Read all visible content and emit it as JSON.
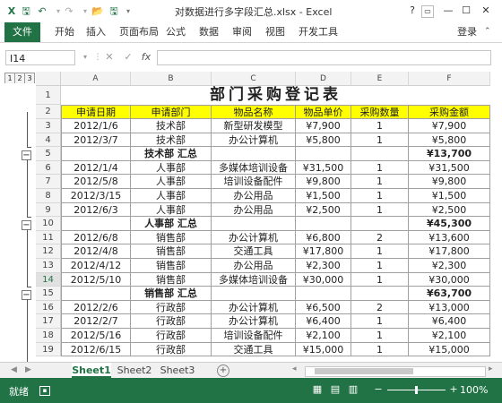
{
  "window": {
    "title": "对数据进行多字段汇总.xlsx - Excel",
    "help": "?",
    "restore_icon": "ribbon-display-icon",
    "minimize": "—",
    "maximize": "☐",
    "close": "✕"
  },
  "qat": {
    "save": "🖫",
    "undo": "↶",
    "redo": "↷",
    "open": "📂",
    "custom": "🖫"
  },
  "ribbon": {
    "file": "文件",
    "tabs": [
      "开始",
      "插入",
      "页面布局",
      "公式",
      "数据",
      "审阅",
      "视图",
      "开发工具"
    ],
    "login": "登录"
  },
  "formula_bar": {
    "name_box": "I14",
    "fx": "fx",
    "cancel": "✕",
    "enter": "✓",
    "value": ""
  },
  "outline": {
    "levels": [
      "1",
      "2",
      "3"
    ],
    "collapse": "−"
  },
  "columns": [
    "A",
    "B",
    "C",
    "D",
    "E",
    "F"
  ],
  "title_row": {
    "row": "1",
    "text": "部门采购登记表"
  },
  "header_row": {
    "row": "2",
    "cells": [
      "申请日期",
      "申请部门",
      "物品名称",
      "物品单价",
      "采购数量",
      "采购金额"
    ]
  },
  "rows": [
    {
      "row": "3",
      "cells": [
        "2012/1/6",
        "技术部",
        "新型研发模型",
        "¥7,900",
        "1",
        "¥7,900"
      ]
    },
    {
      "row": "4",
      "cells": [
        "2012/3/7",
        "技术部",
        "办公计算机",
        "¥5,800",
        "1",
        "¥5,800"
      ]
    },
    {
      "row": "5",
      "cells": [
        "",
        "技术部 汇总",
        "",
        "",
        "",
        "¥13,700"
      ],
      "total": true
    },
    {
      "row": "6",
      "cells": [
        "2012/1/4",
        "人事部",
        "多媒体培训设备",
        "¥31,500",
        "1",
        "¥31,500"
      ]
    },
    {
      "row": "7",
      "cells": [
        "2012/5/8",
        "人事部",
        "培训设备配件",
        "¥9,800",
        "1",
        "¥9,800"
      ]
    },
    {
      "row": "8",
      "cells": [
        "2012/3/15",
        "人事部",
        "办公用品",
        "¥1,500",
        "1",
        "¥1,500"
      ]
    },
    {
      "row": "9",
      "cells": [
        "2012/6/3",
        "人事部",
        "办公用品",
        "¥2,500",
        "1",
        "¥2,500"
      ]
    },
    {
      "row": "10",
      "cells": [
        "",
        "人事部 汇总",
        "",
        "",
        "",
        "¥45,300"
      ],
      "total": true
    },
    {
      "row": "11",
      "cells": [
        "2012/6/8",
        "销售部",
        "办公计算机",
        "¥6,800",
        "2",
        "¥13,600"
      ]
    },
    {
      "row": "12",
      "cells": [
        "2012/4/8",
        "销售部",
        "交通工具",
        "¥17,800",
        "1",
        "¥17,800"
      ]
    },
    {
      "row": "13",
      "cells": [
        "2012/4/12",
        "销售部",
        "办公用品",
        "¥2,300",
        "1",
        "¥2,300"
      ]
    },
    {
      "row": "14",
      "cells": [
        "2012/5/10",
        "销售部",
        "多媒体培训设备",
        "¥30,000",
        "1",
        "¥30,000"
      ]
    },
    {
      "row": "15",
      "cells": [
        "",
        "销售部 汇总",
        "",
        "",
        "",
        "¥63,700"
      ],
      "total": true
    },
    {
      "row": "16",
      "cells": [
        "2012/2/6",
        "行政部",
        "办公计算机",
        "¥6,500",
        "2",
        "¥13,000"
      ]
    },
    {
      "row": "17",
      "cells": [
        "2012/2/7",
        "行政部",
        "办公计算机",
        "¥6,400",
        "1",
        "¥6,400"
      ]
    },
    {
      "row": "18",
      "cells": [
        "2012/5/16",
        "行政部",
        "培训设备配件",
        "¥2,100",
        "1",
        "¥2,100"
      ]
    },
    {
      "row": "19",
      "cells": [
        "2012/6/15",
        "行政部",
        "交通工具",
        "¥15,000",
        "1",
        "¥15,000"
      ]
    }
  ],
  "selected_row": "14",
  "sheets": {
    "tabs": [
      "Sheet1",
      "Sheet2",
      "Sheet3"
    ],
    "active": "Sheet1",
    "add": "+"
  },
  "status": {
    "ready": "就绪",
    "zoom": "100%",
    "zoom_minus": "−",
    "zoom_plus": "+"
  },
  "colors": {
    "accent": "#217346",
    "header_fill": "#ffff00"
  }
}
